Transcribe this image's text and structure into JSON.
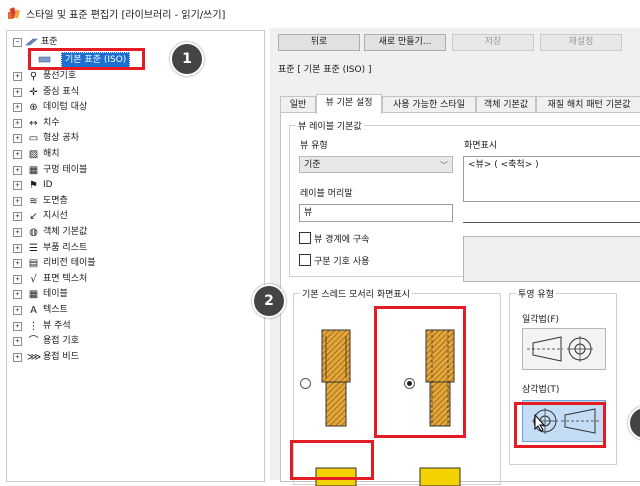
{
  "window": {
    "title": "스타일 및 표준 편집기 [라이브러리 - 읽기/쓰기]"
  },
  "tree": {
    "root_label": "표준",
    "selected_label": "기본 표준 (ISO)",
    "items": [
      {
        "label": "풍선기호",
        "icon": "balloon-icon"
      },
      {
        "label": "중심 표식",
        "icon": "center-mark-icon"
      },
      {
        "label": "데이텀 대상",
        "icon": "datum-target-icon"
      },
      {
        "label": "치수",
        "icon": "dimension-icon"
      },
      {
        "label": "형상 공차",
        "icon": "feature-control-frame-icon"
      },
      {
        "label": "해치",
        "icon": "hatch-icon"
      },
      {
        "label": "구멍 테이블",
        "icon": "hole-table-icon"
      },
      {
        "label": "ID",
        "icon": "id-icon"
      },
      {
        "label": "도면층",
        "icon": "layers-icon"
      },
      {
        "label": "지시선",
        "icon": "leader-icon"
      },
      {
        "label": "객체 기본값",
        "icon": "object-defaults-icon"
      },
      {
        "label": "부품 리스트",
        "icon": "parts-list-icon"
      },
      {
        "label": "리비전 테이블",
        "icon": "revision-table-icon"
      },
      {
        "label": "표면 텍스처",
        "icon": "surface-texture-icon"
      },
      {
        "label": "테이블",
        "icon": "table-icon"
      },
      {
        "label": "텍스트",
        "icon": "text-icon"
      },
      {
        "label": "뷰 주석",
        "icon": "view-annotation-icon"
      },
      {
        "label": "용접 기호",
        "icon": "weld-symbol-icon"
      },
      {
        "label": "용접 비드",
        "icon": "weld-bead-icon"
      }
    ]
  },
  "badges": {
    "one": "1",
    "two": "2"
  },
  "toolbar": {
    "back": "뒤로",
    "new": "새로 만들기...",
    "save": "저장",
    "reset": "재설정"
  },
  "section": {
    "title": "표준 [ 기본 표준 (ISO) ]"
  },
  "tabs": [
    {
      "label": "일반",
      "active": false
    },
    {
      "label": "뷰 기본 설정",
      "active": true
    },
    {
      "label": "사용 가능한 스타일",
      "active": false
    },
    {
      "label": "객체 기본값",
      "active": false
    },
    {
      "label": "재질 해치 패턴 기본값",
      "active": false
    }
  ],
  "view_label_defaults": {
    "group_title": "뷰 레이블 기본값",
    "view_type_label": "뷰 유형",
    "view_type_value": "기준",
    "display_label": "화면표시",
    "display_value": "<뷰> ( <축척> )",
    "label_prefix_label": "레이블 머리말",
    "label_prefix_value": "뷰",
    "constrain_to_border": "뷰 경계에 구속",
    "use_delimiter": "구분 기호 사용"
  },
  "thread_display": {
    "group_title": "기본 스레드 모서리 화면표시",
    "selected": "second"
  },
  "projection": {
    "group_title": "투영 유형",
    "first_angle": "일각법(F)",
    "third_angle": "삼각법(T)",
    "selected": "third"
  },
  "colors": {
    "accent": "#e31b23",
    "selection": "#1a6fd1"
  }
}
